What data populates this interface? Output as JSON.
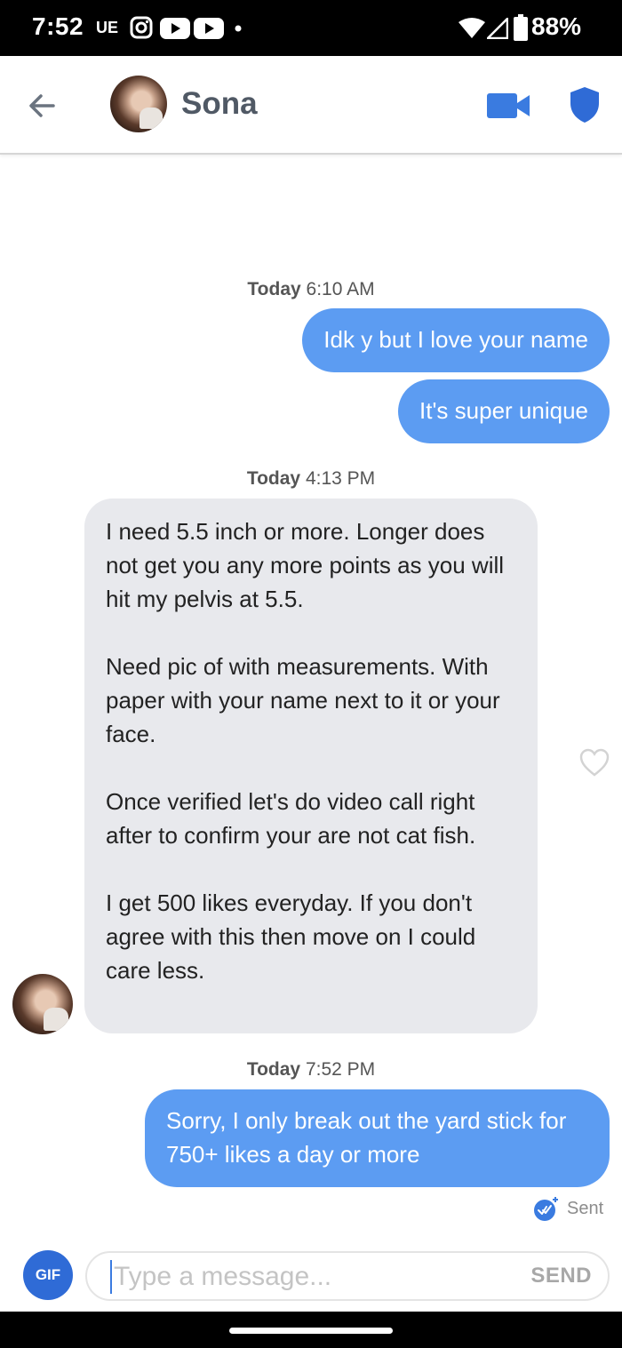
{
  "status_bar": {
    "time": "7:52",
    "carrier_badge": "UE",
    "battery_percent": "88%",
    "icons": [
      "instagram-icon",
      "youtube-icon",
      "youtube-icon",
      "dot-icon",
      "wifi-icon",
      "signal-icon",
      "battery-icon"
    ]
  },
  "header": {
    "back_icon": "arrow-left-icon",
    "contact_name": "Sona",
    "video_icon": "video-camera-icon",
    "safety_icon": "shield-icon"
  },
  "conversation": {
    "groups": [
      {
        "timestamp_day": "Today",
        "timestamp_time": "6:10 AM",
        "messages": [
          {
            "direction": "out",
            "text": "Idk y but I love your name"
          },
          {
            "direction": "out",
            "text": "It's super unique"
          }
        ]
      },
      {
        "timestamp_day": "Today",
        "timestamp_time": "4:13 PM",
        "messages": [
          {
            "direction": "in",
            "text": "I need 5.5 inch or more. Longer does not get you any more points as you will hit my pelvis at 5.5.\n\nNeed pic of with measurements. With paper with your name next to it or your face.\n\nOnce verified let's do video call right after to confirm your are not cat fish.\n\nI get 500 likes everyday. If you don't agree with this then move on I could care less."
          }
        ]
      },
      {
        "timestamp_day": "Today",
        "timestamp_time": "7:52 PM",
        "messages": [
          {
            "direction": "out",
            "text": "Sorry, I only break out the yard stick for 750+ likes a day or more"
          }
        ]
      }
    ],
    "delivery_status": "Sent"
  },
  "compose": {
    "gif_label": "GIF",
    "placeholder": "Type a message...",
    "value": "",
    "send_label": "SEND"
  },
  "colors": {
    "outgoing_bubble": "#5c9cf2",
    "incoming_bubble": "#e8e9ed",
    "accent_blue": "#2f6bd6",
    "header_icon_blue": "#3a7be0"
  }
}
